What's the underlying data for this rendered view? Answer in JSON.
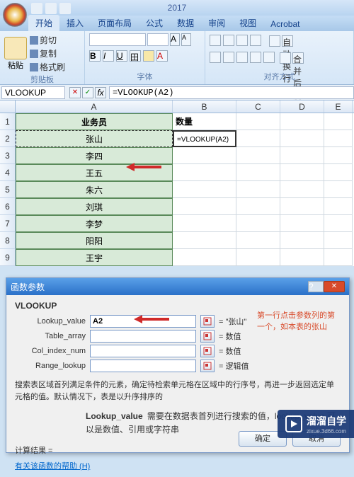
{
  "app_title": "2017",
  "tabs": [
    "开始",
    "插入",
    "页面布局",
    "公式",
    "数据",
    "审阅",
    "视图",
    "Acrobat"
  ],
  "active_tab": 0,
  "ribbon": {
    "clipboard": {
      "label": "剪贴板",
      "cut": "剪切",
      "copy": "复制",
      "format": "格式刷",
      "paste": "粘贴"
    },
    "font": {
      "label": "字体"
    },
    "align": {
      "label": "对齐方式",
      "wrap": "自动换行",
      "merge": "合并后居中"
    }
  },
  "namebox": "VLOOKUP",
  "formula": "=VLOOKUP(A2)",
  "columns": [
    "A",
    "B",
    "C",
    "D",
    "E"
  ],
  "rows": [
    {
      "n": "1",
      "A": "业务员",
      "B": "数量"
    },
    {
      "n": "2",
      "A": "张山",
      "B": "=VLOOKUP(A2)"
    },
    {
      "n": "3",
      "A": "李四",
      "B": ""
    },
    {
      "n": "4",
      "A": "王五",
      "B": ""
    },
    {
      "n": "5",
      "A": "朱六",
      "B": ""
    },
    {
      "n": "6",
      "A": "刘琪",
      "B": ""
    },
    {
      "n": "7",
      "A": "李梦",
      "B": ""
    },
    {
      "n": "8",
      "A": "阳阳",
      "B": ""
    },
    {
      "n": "9",
      "A": "王宇",
      "B": ""
    }
  ],
  "dialog": {
    "title": "函数参数",
    "fn": "VLOOKUP",
    "params": {
      "lookup_value": {
        "label": "Lookup_value",
        "value": "A2",
        "result": "= \"张山\""
      },
      "table_array": {
        "label": "Table_array",
        "value": "",
        "result": "= 数值"
      },
      "col_index_num": {
        "label": "Col_index_num",
        "value": "",
        "result": "= 数值"
      },
      "range_lookup": {
        "label": "Range_lookup",
        "value": "",
        "result": "= 逻辑值"
      }
    },
    "annotation": "第一行点击参数列的第一个，如本表的张山",
    "desc1": "搜索表区域首列满足条件的元素，确定待检索单元格在区域中的行序号，再进一步返回选定单元格的值。默认情况下，表是以升序排序的",
    "desc2_label": "Lookup_value",
    "desc2": "需要在数据表首列进行搜索的值，lookup_value 可以是数值、引用或字符串",
    "result_label": "计算结果 =",
    "help": "有关该函数的帮助 (H)",
    "ok": "确定",
    "cancel": "取消"
  },
  "watermark": "溜溜自学"
}
